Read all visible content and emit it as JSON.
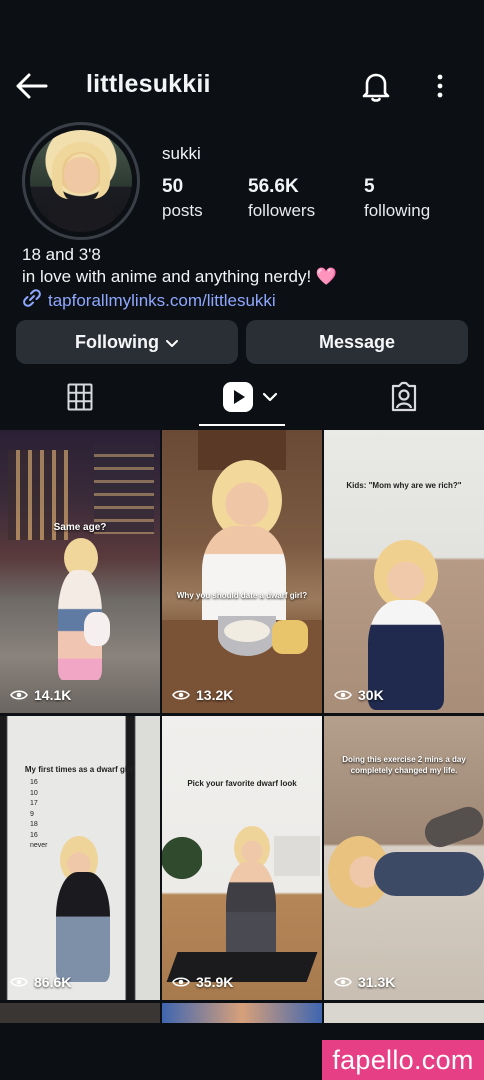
{
  "header": {
    "username": "littlesukkii"
  },
  "profile": {
    "display_name": "sukki",
    "stats": [
      {
        "value": "50",
        "label": "posts"
      },
      {
        "value": "56.6K",
        "label": "followers"
      },
      {
        "value": "5",
        "label": "following"
      }
    ],
    "bio_line1": "18 and 3'8",
    "bio_line2": "in love with anime and anything nerdy! 🩷",
    "link": "tapforallmylinks.com/littlesukki"
  },
  "actions": {
    "following_label": "Following",
    "message_label": "Message"
  },
  "tabs": [
    "grid-icon",
    "reels-icon",
    "tagged-icon"
  ],
  "videos": [
    {
      "views": "14.1K",
      "caption": "Same age?"
    },
    {
      "views": "13.2K",
      "caption": "Why you should date a dwarf girl?"
    },
    {
      "views": "30K",
      "caption": "Kids: \"Mom why are we rich?\""
    },
    {
      "views": "86.6K",
      "caption": "My first times as a dwarf girl:"
    },
    {
      "views": "35.9K",
      "caption": "Pick your favorite dwarf look"
    },
    {
      "views": "31.3K",
      "caption": "Doing this exercise 2 mins a day completely changed my life."
    }
  ],
  "tile4_list": [
    "16",
    "10",
    "17",
    "9",
    "18",
    "16",
    "never"
  ],
  "watermark": "fapello.com",
  "colors": {
    "background": "#0c0f14",
    "button": "#2a2e35",
    "link": "#8fa8ff",
    "watermark": "#e73f86"
  }
}
